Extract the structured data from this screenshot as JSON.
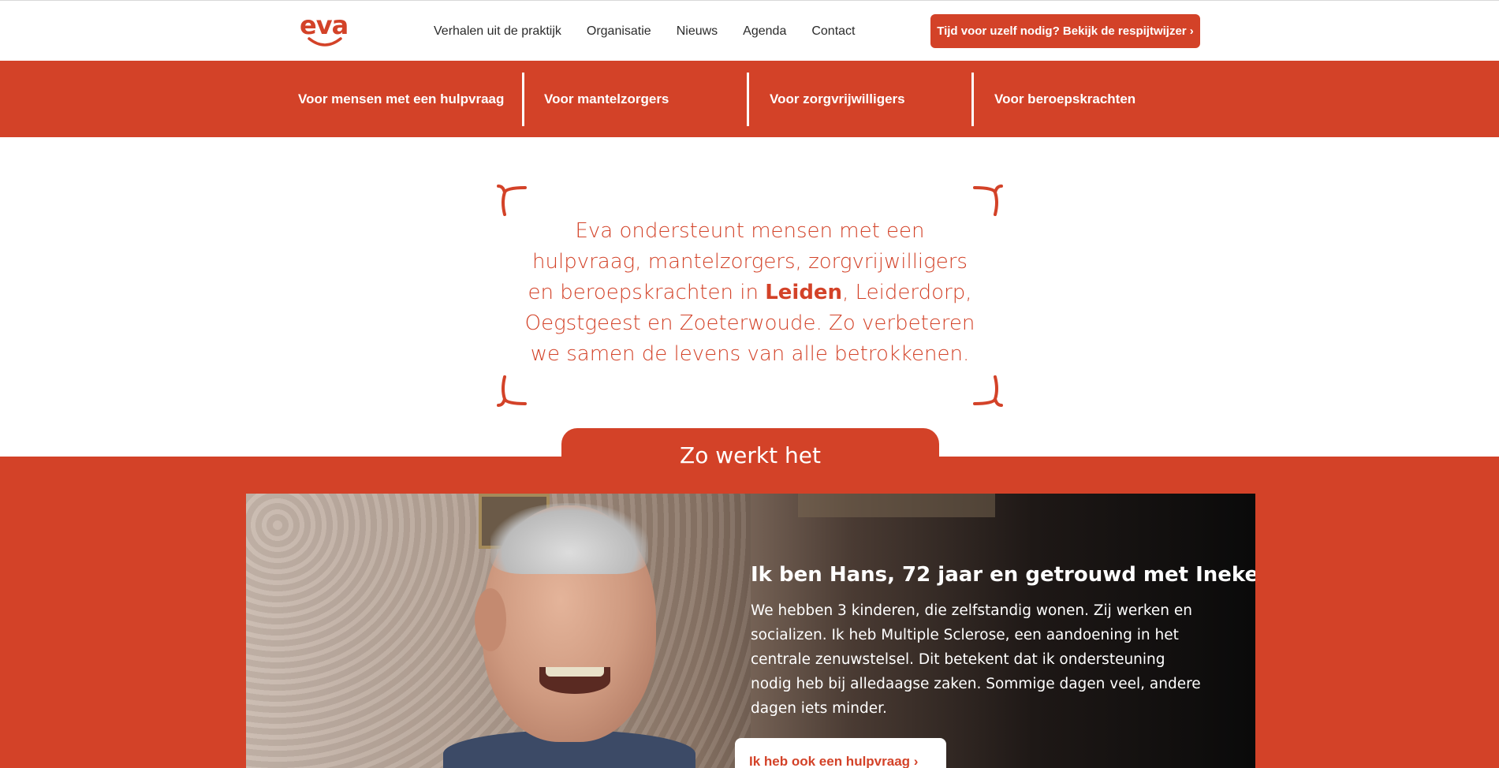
{
  "brand": {
    "logo_text": "eva",
    "accent_color": "#d34228"
  },
  "topnav": {
    "items": [
      "Verhalen uit de praktijk",
      "Organisatie",
      "Nieuws",
      "Agenda",
      "Contact"
    ],
    "cta_label": "Tijd voor uzelf nodig? Bekijk de respijtwijzer ›"
  },
  "audiences": [
    "Voor mensen met een hulpvraag",
    "Voor mantelzorgers",
    "Voor zorgvrijwilligers",
    "Voor beroepskrachten"
  ],
  "intro": {
    "before": "Eva ondersteunt mensen met een hulpvraag, mantelzorgers, zorgvrijwilligers en beroepskrachten in ",
    "bold": "Leiden",
    "after": ", Leiderdorp, Oegstgeest en Zoeterwoude. Zo verbeteren we samen de levens van alle betrokkenen."
  },
  "how_it_works": {
    "title": "Zo werkt het",
    "story_title": "Ik ben Hans, 72 jaar en getrouwd met Ineke",
    "story_text": "We hebben 3 kinderen, die zelfstandig wonen. Zij werken en socializen. Ik heb Multiple Sclerose, een aandoening in het centrale zenuwstelsel. Dit betekent dat ik ondersteuning nodig heb bij alledaagse zaken. Sommige dagen veel, andere dagen iets minder.",
    "button_label": "Ik heb ook een hulpvraag ›"
  }
}
